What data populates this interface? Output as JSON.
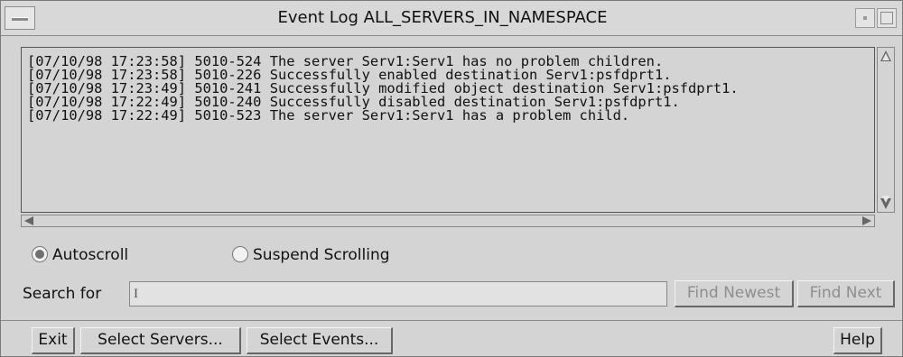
{
  "window": {
    "title": "Event Log  ALL_SERVERS_IN_NAMESPACE"
  },
  "log": {
    "lines": [
      "[07/10/98 17:23:58] 5010-524 The server Serv1:Serv1 has no problem children.",
      "[07/10/98 17:23:58] 5010-226 Successfully enabled destination Serv1:psfdprt1.",
      "[07/10/98 17:23:49] 5010-241 Successfully modified object destination Serv1:psfdprt1.",
      "[07/10/98 17:22:49] 5010-240 Successfully disabled destination Serv1:psfdprt1.",
      "[07/10/98 17:22:49] 5010-523 The server Serv1:Serv1 has a problem child."
    ]
  },
  "options": {
    "autoscroll_label": "Autoscroll",
    "suspend_label": "Suspend Scrolling",
    "selected": "Autoscroll"
  },
  "search": {
    "label": "Search for",
    "value": "",
    "find_newest": "Find Newest",
    "find_next": "Find Next"
  },
  "buttons": {
    "exit": "Exit",
    "select_servers": "Select Servers...",
    "select_events": "Select Events...",
    "help": "Help"
  },
  "icons": {
    "system_menu": "system-menu-icon",
    "minimize": "minimize-icon",
    "maximize": "maximize-icon",
    "scroll_up": "scroll-up-arrow-icon",
    "scroll_down": "scroll-down-arrow-icon",
    "scroll_left": "scroll-left-arrow-icon",
    "scroll_right": "scroll-right-arrow-icon"
  }
}
